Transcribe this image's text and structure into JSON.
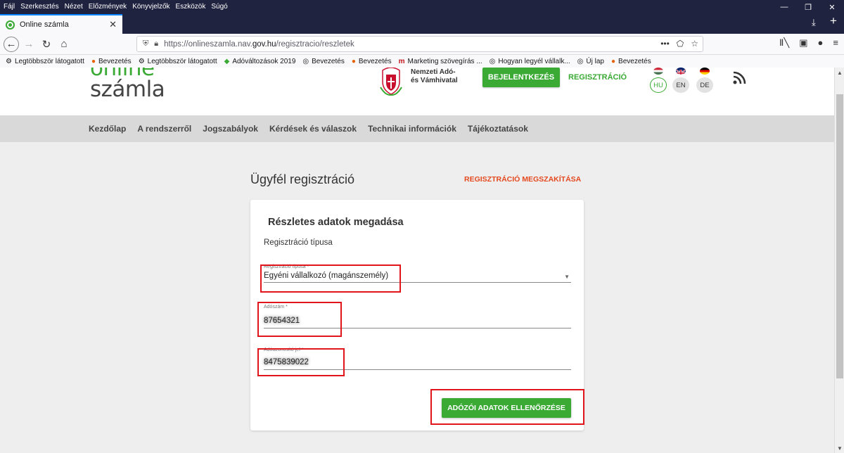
{
  "browser": {
    "menu": [
      "Fájl",
      "Szerkesztés",
      "Nézet",
      "Előzmények",
      "Könyvjelzők",
      "Eszközök",
      "Súgó"
    ],
    "tab_title": "Online számla",
    "url_prefix": "https://onlineszamla.nav.",
    "url_domain": "gov.hu",
    "url_path": "/regisztracio/reszletek",
    "bookmarks": [
      {
        "label": "Legtöbbször látogatott",
        "icon": "gear-icon"
      },
      {
        "label": "Bevezetés",
        "icon": "firefox-icon"
      },
      {
        "label": "Legtöbbször látogatott",
        "icon": "gear-icon"
      },
      {
        "label": "Adóváltozások 2019",
        "icon": "site-icon"
      },
      {
        "label": "Bevezetés",
        "icon": "globe-icon"
      },
      {
        "label": "Bevezetés",
        "icon": "firefox-icon"
      },
      {
        "label": "Marketing szövegírás ...",
        "icon": "m-icon"
      },
      {
        "label": "Hogyan legyél vállalk...",
        "icon": "globe-icon"
      },
      {
        "label": "Új lap",
        "icon": "globe-icon"
      },
      {
        "label": "Bevezetés",
        "icon": "firefox-icon"
      }
    ]
  },
  "header": {
    "logo_line1": "online",
    "logo_line2": "számla",
    "nav_name_line1": "Nemzeti Adó-",
    "nav_name_line2": "és Vámhivatal",
    "login_button": "BEJELENTKEZÉS",
    "register_link": "REGISZTRÁCIÓ",
    "languages": [
      {
        "code": "HU",
        "active": true
      },
      {
        "code": "EN",
        "active": false
      },
      {
        "code": "DE",
        "active": false
      }
    ]
  },
  "mainnav": [
    "Kezdőlap",
    "A rendszerről",
    "Jogszabályok",
    "Kérdések és válaszok",
    "Technikai információk",
    "Tájékoztatások"
  ],
  "page": {
    "title": "Ügyfél regisztráció",
    "cancel_link": "REGISZTRÁCIÓ MEGSZAKÍTÁSA"
  },
  "card": {
    "title": "Részletes adatok megadása",
    "subtitle": "Regisztráció típusa",
    "fields": {
      "type_label": "Regisztráció típusa *",
      "type_value": "Egyéni vállalkozó (magánszemély)",
      "tax_number_label": "Adószám *",
      "tax_number_value": "87654321",
      "tax_id_label": "Adóazonosító jel *",
      "tax_id_value": "8475839022"
    },
    "check_button": "ADÓZÓI ADATOK ELLENŐRZÉSE"
  },
  "colors": {
    "brand_green": "#3aaa35",
    "cancel_orange": "#e4491f",
    "highlight_red": "#e0161c",
    "chrome_dark": "#202340"
  }
}
